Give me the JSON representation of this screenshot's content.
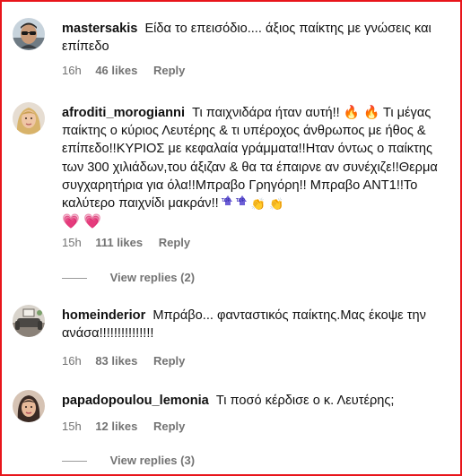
{
  "comments": [
    {
      "username": "mastersakis",
      "avatar_icon": "man-with-sunglasses-avatar",
      "text": "Είδα το επεισόδιο.... άξιος παίκτης με γνώσεις και επίπεδο",
      "time": "16h",
      "likes": "46 likes",
      "reply_label": "Reply"
    },
    {
      "username": "afroditi_morogianni",
      "avatar_icon": "blonde-woman-avatar",
      "text": "Τι παιχνιδάρα ήταν αυτή!! 🔥 🔥 Τι μέγας παίκτης ο κύριος Λευτέρης & τι υπέροχος άνθρωπος με ήθος & επίπεδο!!ΚΥΡΙΟΣ με κεφαλαία γράμματα!!Ηταν όντως ο παίκτης των 300 χιλιάδων,του άξιζαν & θα τα έπαιρνε αν συνέχιζε!!Θερμα συγχαρητήρια για όλα!!Μπραβο Γρηγόρη!! Μπραβο ΑΝΤ1!!Το καλύτερο παιχνίδι μακράν!!",
      "emoji_tail": [
        "top-icon",
        "top-icon",
        "clapping-hands-icon",
        "clapping-hands-icon",
        "heart-icon",
        "heart-icon"
      ],
      "top_badge_text": "TOP",
      "clap_glyph": "👏",
      "heart_glyph": "💗",
      "time": "15h",
      "likes": "111 likes",
      "reply_label": "Reply",
      "view_replies": "View replies (2)"
    },
    {
      "username": "homeinderior",
      "avatar_icon": "living-room-avatar",
      "text": "Μπράβο... φανταστικός παίκτης.Μας έκοψε την ανάσα!!!!!!!!!!!!!!!",
      "time": "16h",
      "likes": "83 likes",
      "reply_label": "Reply"
    },
    {
      "username": "papadopoulou_lemonia",
      "avatar_icon": "woman-with-dark-hair-avatar",
      "text": "Τι ποσό κέρδισε ο κ. Λευτέρης;",
      "time": "15h",
      "likes": "12 likes",
      "reply_label": "Reply",
      "view_replies": "View replies (3)"
    }
  ],
  "colors": {
    "frame_border": "#e8151b",
    "meta_text": "#737373",
    "fire": "#ff6a00",
    "heart": "#ff3d7f",
    "top_badge": "#6d5fd6"
  }
}
